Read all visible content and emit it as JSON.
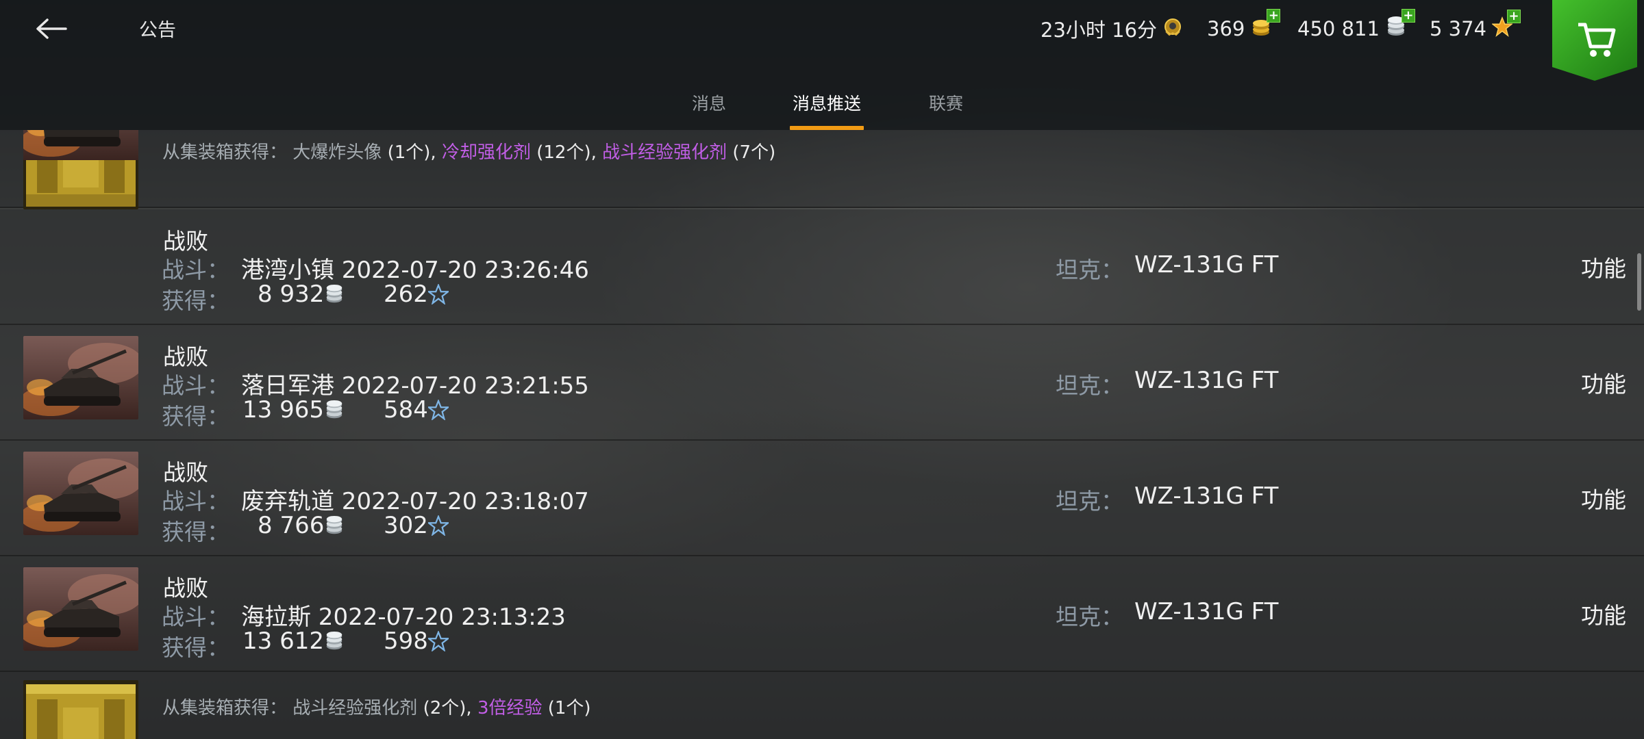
{
  "header": {
    "title": "公告",
    "timer": "23小时 16分",
    "gold": "369",
    "credits": "450 811",
    "free_xp": "5 374"
  },
  "tabs": [
    {
      "label": "消息",
      "active": false
    },
    {
      "label": "消息推送",
      "active": true
    },
    {
      "label": "联赛",
      "active": false
    }
  ],
  "loot_top": {
    "prefix": "从集装箱获得：",
    "items": [
      {
        "name": "大爆炸头像",
        "count": "(1个)",
        "purple": false
      },
      {
        "name": "冷却强化剂",
        "count": "(12个)",
        "purple": true
      },
      {
        "name": "战斗经验强化剂",
        "count": "(7个)",
        "purple": true
      }
    ]
  },
  "labels": {
    "battle": "战斗：",
    "earned": "获得：",
    "tank": "坦克：",
    "function": "功能"
  },
  "battles": [
    {
      "result": "战败",
      "map": "港湾小镇 2022-07-20 23:26:46",
      "credits": "8 932",
      "xp": "262",
      "tank": "WZ-131G FT"
    },
    {
      "result": "战败",
      "map": "落日军港 2022-07-20 23:21:55",
      "credits": "13 965",
      "xp": "584",
      "tank": "WZ-131G FT"
    },
    {
      "result": "战败",
      "map": "废弃轨道 2022-07-20 23:18:07",
      "credits": "8 766",
      "xp": "302",
      "tank": "WZ-131G FT"
    },
    {
      "result": "战败",
      "map": "海拉斯 2022-07-20 23:13:23",
      "credits": "13 612",
      "xp": "598",
      "tank": "WZ-131G FT"
    }
  ],
  "loot_bottom": {
    "prefix": "从集装箱获得：",
    "items": [
      {
        "name": "战斗经验强化剂",
        "count": "(2个)",
        "purple": false
      },
      {
        "name": "3倍经验",
        "count": "(1个)",
        "purple": true
      }
    ]
  },
  "colors": {
    "accent_tab": "#f29b14",
    "purple_item": "#c15ee6",
    "label_gray": "#8e9aa6",
    "shop_green": "#2d9a1f"
  }
}
